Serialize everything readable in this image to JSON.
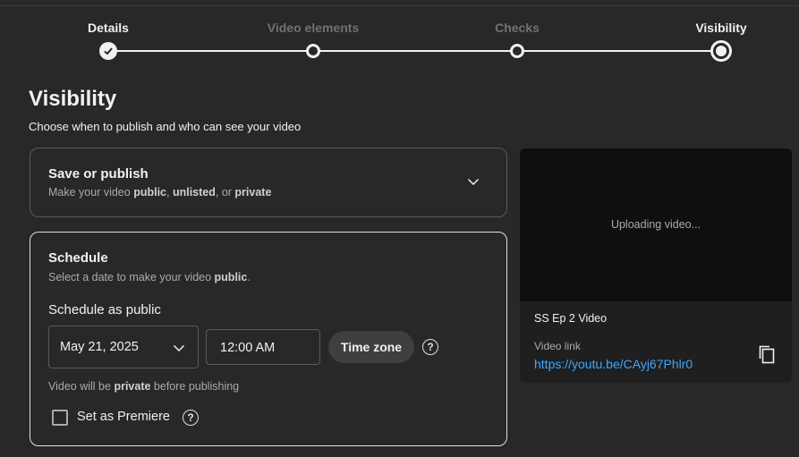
{
  "stepper": {
    "steps": [
      {
        "label": "Details",
        "state": "done"
      },
      {
        "label": "Video elements",
        "state": "pending"
      },
      {
        "label": "Checks",
        "state": "pending"
      },
      {
        "label": "Visibility",
        "state": "current"
      }
    ]
  },
  "page": {
    "title": "Visibility",
    "subtitle": "Choose when to publish and who can see your video"
  },
  "save_card": {
    "title": "Save or publish",
    "sub_prefix": "Make your video ",
    "sub_public": "public",
    "sub_sep1": ", ",
    "sub_unlisted": "unlisted",
    "sub_sep2": ", or ",
    "sub_private": "private",
    "expand_icon": "chevron-down-icon"
  },
  "schedule_card": {
    "title": "Schedule",
    "sub_prefix": "Select a date to make your video ",
    "sub_public": "public",
    "sub_suffix": ".",
    "schedule_label": "Schedule as public",
    "date_value": "May 21, 2025",
    "time_value": "12:00 AM",
    "timezone_label": "Time zone",
    "note_prefix": "Video will be ",
    "note_private": "private",
    "note_suffix": " before publishing",
    "premiere_label": "Set as Premiere",
    "premiere_checked": false
  },
  "preview": {
    "status": "Uploading video...",
    "video_title": "SS Ep 2 Video",
    "link_label": "Video link",
    "link_url": "https://youtu.be/CAyj67Phlr0"
  },
  "colors": {
    "background": "#282828",
    "link": "#3ea6ff",
    "text": "#f1f1f1",
    "muted": "#aaaaaa"
  }
}
